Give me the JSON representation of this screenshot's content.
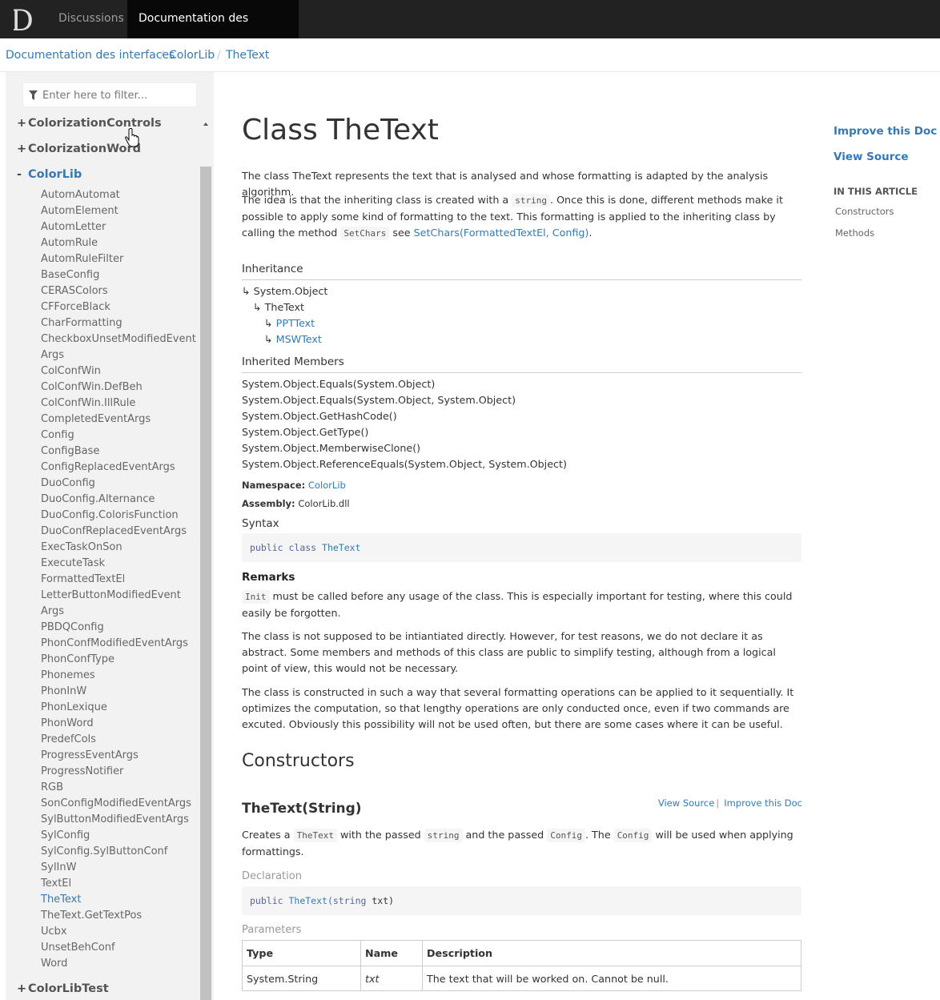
{
  "nav": {
    "tabs": [
      {
        "label": "Discussions"
      },
      {
        "label": "Documentation des interfaces"
      }
    ]
  },
  "breadcrumb": [
    {
      "label": "Documentation des interfaces"
    },
    {
      "label": "ColorLib"
    },
    {
      "label": "TheText"
    }
  ],
  "sidebar": {
    "filter_placeholder": "Enter here to filter...",
    "namespaces": [
      {
        "expander": "+",
        "label": "ColorizationControls"
      },
      {
        "expander": "+",
        "label": "ColorizationWord"
      },
      {
        "expander": "-",
        "label": "ColorLib"
      },
      {
        "expander": "+",
        "label": "ColorLibTest"
      }
    ],
    "items": [
      "AutomAutomat",
      "AutomElement",
      "AutomLetter",
      "AutomRule",
      "AutomRuleFilter",
      "BaseConfig",
      "CERASColors",
      "CFForceBlack",
      "CharFormatting",
      "CheckboxUnsetModifiedEvent",
      "Args",
      "ColConfWin",
      "ColConfWin.DefBeh",
      "ColConfWin.IllRule",
      "CompletedEventArgs",
      "Config",
      "ConfigBase",
      "ConfigReplacedEventArgs",
      "DuoConfig",
      "DuoConfig.Alternance",
      "DuoConfig.ColorisFunction",
      "DuoConfReplacedEventArgs",
      "ExecTaskOnSon",
      "ExecuteTask",
      "FormattedTextEl",
      "LetterButtonModifiedEvent",
      "Args",
      "PBDQConfig",
      "PhonConfModifiedEventArgs",
      "PhonConfType",
      "Phonemes",
      "PhonInW",
      "PhonLexique",
      "PhonWord",
      "PredefCols",
      "ProgressEventArgs",
      "ProgressNotifier",
      "RGB",
      "SonConfigModifiedEventArgs",
      "SylButtonModifiedEventArgs",
      "SylConfig",
      "SylConfig.SylButtonConf",
      "SylInW",
      "TextEl",
      "TheText",
      "TheText.GetTextPos",
      "Ucbx",
      "UnsetBehConf",
      "Word"
    ]
  },
  "article": {
    "title": "Class TheText",
    "intro": "The class TheText represents the text that is analysed and whose formatting is adapted by the analysis algorithm.",
    "idea": {
      "part1": "The idea is that the inheriting class is created with a ",
      "code1": "string",
      "part2": ". Once this is done, different methods make it possible to apply some kind of formatting to the text. This formatting is applied to the inheriting class by calling the method ",
      "code2": "SetChars",
      "part3": " see ",
      "link": "SetChars(FormattedTextEl, Config)",
      "part4": "."
    },
    "inheritance_title": "Inheritance",
    "inheritance": [
      "System.Object",
      "TheText",
      "PPTText",
      "MSWText"
    ],
    "inherited_members_title": "Inherited Members",
    "inherited_members": [
      "System.Object.Equals(System.Object)",
      "System.Object.Equals(System.Object, System.Object)",
      "System.Object.GetHashCode()",
      "System.Object.GetType()",
      "System.Object.MemberwiseClone()",
      "System.Object.ReferenceEquals(System.Object, System.Object)"
    ],
    "namespace_label": "Namespace",
    "namespace_value": "ColorLib",
    "assembly_label": "Assembly",
    "assembly_value": "ColorLib.dll",
    "syntax_title": "Syntax",
    "syntax_code": {
      "kw1": "public",
      "kw2": "class",
      "name": "TheText"
    },
    "remarks_title": "Remarks",
    "remarks_code": "Init",
    "remarks1": " must be called before any usage of the class. This is especially important for testing, where this could easily be forgotten.",
    "remarks2": "The class is not supposed to be intiantiated directly. However, for test reasons, we do not declare it as abstract. Some members and methods of this class are public to simplify testing, although from a logical point of view, this would not be necessary.",
    "remarks3": "The class is constructed in such a way that several formatting operations can be applied to it sequentially. It optimizes the computation, so that lengthy operations are only conducted once, even if two commands are excuted. Obviously this possibility will not be used often, but there are some cases where it can be useful.",
    "constructors_title": "Constructors",
    "ctor": {
      "title": "TheText(String)",
      "view_source": "View Source",
      "improve": "Improve this Doc",
      "desc": {
        "p1": "Creates a ",
        "c1": "TheText",
        "p2": " with the passed ",
        "c2": "string",
        "p3": " and the passed ",
        "c3": "Config",
        "p4": ". The ",
        "c4": "Config",
        "p5": " will be used when applying formattings."
      },
      "declaration_title": "Declaration",
      "declaration": {
        "kw": "public",
        "name": "TheText(",
        "type": "string",
        "rest": " txt)"
      },
      "parameters_title": "Parameters",
      "table": {
        "headers": [
          "Type",
          "Name",
          "Description"
        ],
        "rows": [
          [
            "System.String",
            "txt",
            "The text that will be worked on. Cannot be null."
          ]
        ]
      }
    }
  },
  "affix": {
    "improve": "Improve this Doc",
    "view_source": "View Source",
    "header": "IN THIS ARTICLE",
    "links": [
      "Constructors",
      "Methods"
    ]
  },
  "colors": {
    "link": "#337ab7",
    "navbar": "#222222",
    "sidebar_bg": "#f2f2f2"
  }
}
